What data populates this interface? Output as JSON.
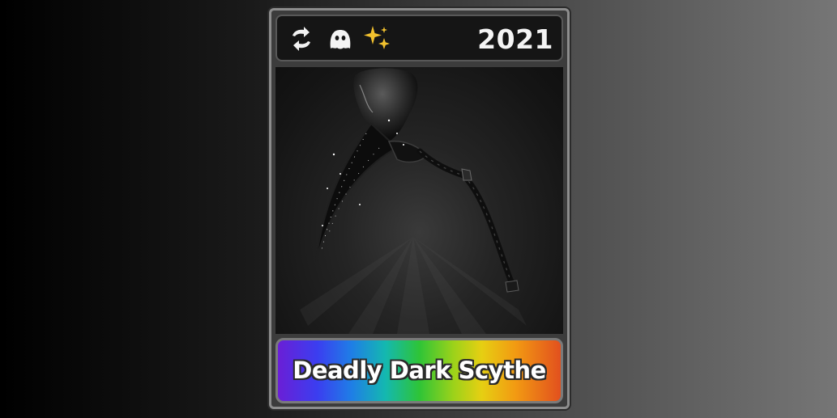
{
  "card": {
    "year": "2021",
    "item_name": "Deadly Dark Scythe",
    "badges": [
      {
        "icon": "trade-arrows-icon"
      },
      {
        "icon": "ghost-icon"
      },
      {
        "icon": "sparkle-icon",
        "color": "#f2c12e"
      }
    ],
    "item_image": "scythe-image",
    "name_banner_style": "rainbow",
    "colors": {
      "frame": "#8d8d8d",
      "header_bg": "#151515",
      "sparkle": "#f2c12e"
    }
  }
}
